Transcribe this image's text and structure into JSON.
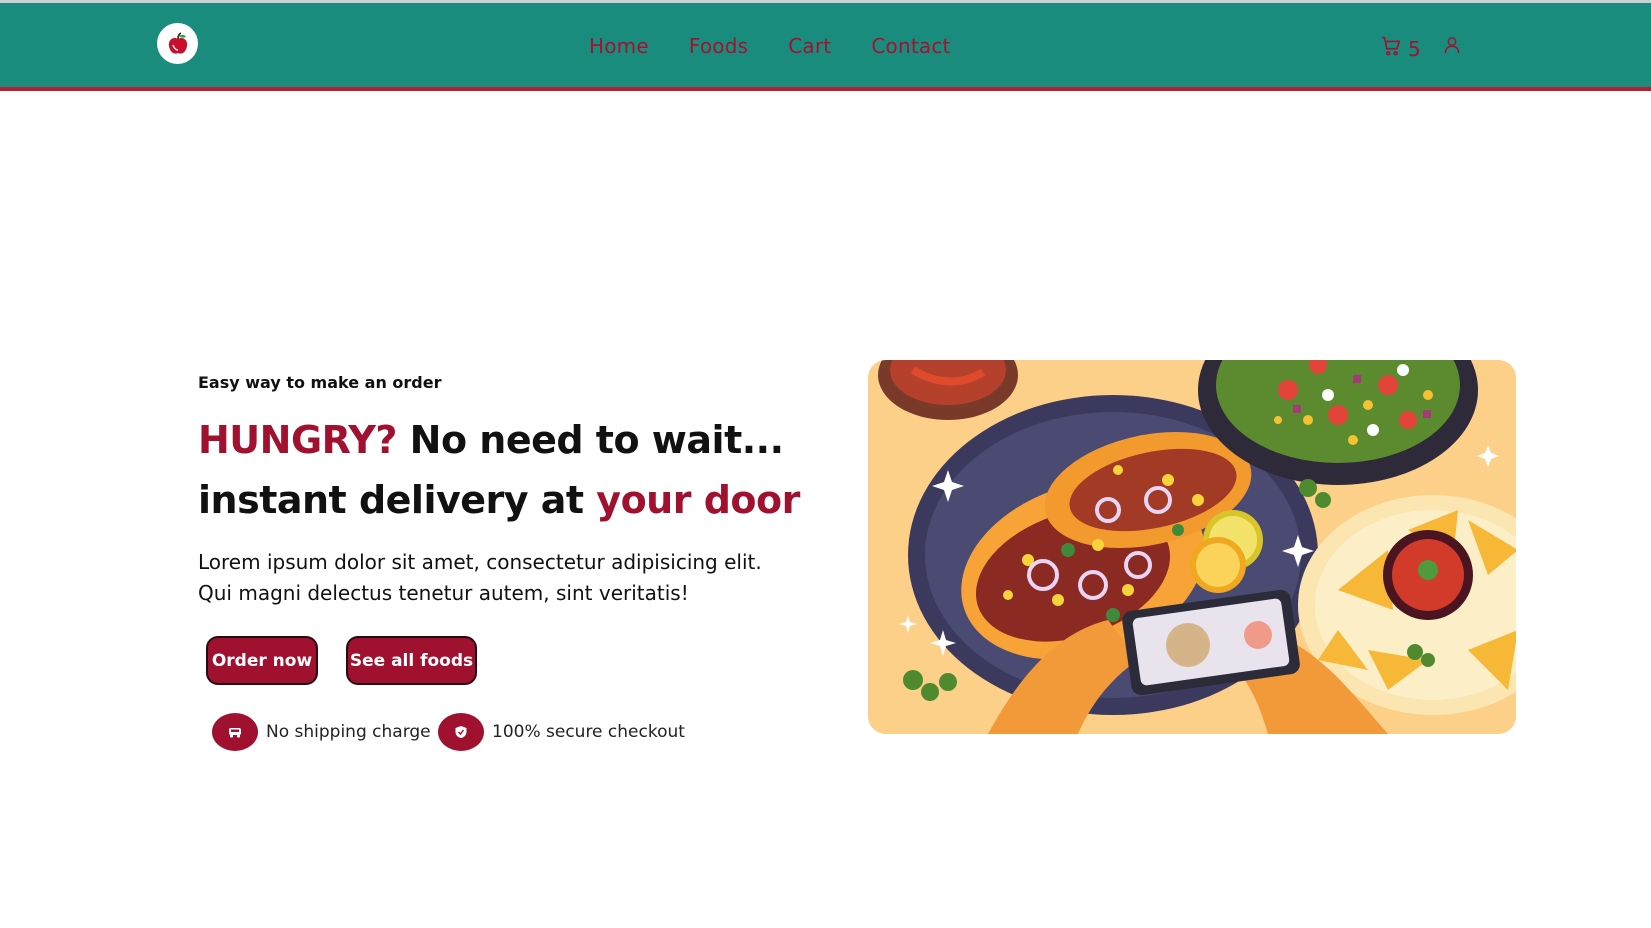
{
  "nav": {
    "logo": "apple-logo",
    "links": [
      "Home",
      "Foods",
      "Cart",
      "Contact"
    ],
    "cart_count": "5",
    "icons": [
      "cart-icon",
      "user-icon"
    ],
    "accent_color": "#a0102f",
    "header_color": "#1a8c7d"
  },
  "hero": {
    "tagline": "Easy way to make an order",
    "title_part1": "HUNGRY?",
    "title_part2": " No need to wait... instant delivery at ",
    "title_part3": "your door",
    "description": "Lorem ipsum dolor sit amet, consectetur adipisicing elit. Qui magni delectus tenetur autem, sint veritatis!",
    "order_button": "Order now",
    "foods_button": "See all foods",
    "features": [
      {
        "icon": "car-icon",
        "label": "No shipping charge"
      },
      {
        "icon": "shield-icon",
        "label": "100% secure checkout"
      }
    ],
    "image": "food-illustration"
  }
}
